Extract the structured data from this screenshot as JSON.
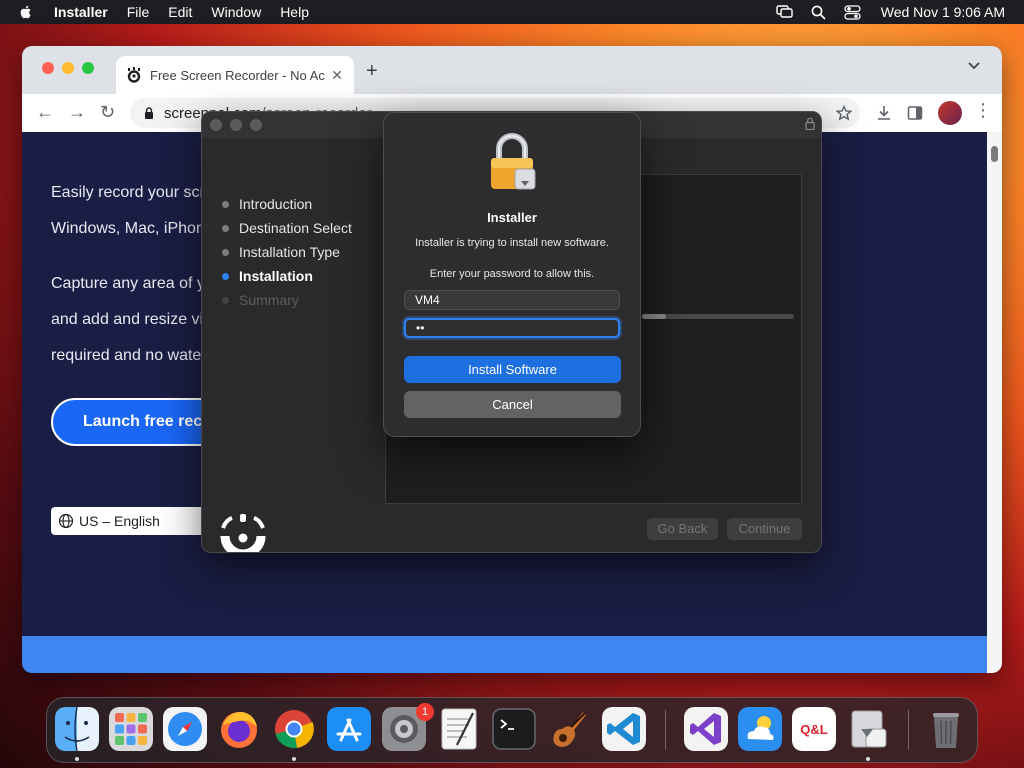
{
  "menubar": {
    "app_name": "Installer",
    "menus": [
      "File",
      "Edit",
      "Window",
      "Help"
    ],
    "clock": "Wed Nov 1  9:06 AM",
    "icons": [
      "apple-icon",
      "screen-mirroring-icon",
      "search-icon",
      "control-center-icon"
    ]
  },
  "browser": {
    "tab_title": "Free Screen Recorder - No Ac",
    "url_main": "screenpal.com",
    "url_rest": "/screen-recorder",
    "colors": {
      "page_bg": "#1b1e44",
      "accent": "#1a66f5"
    }
  },
  "page": {
    "lines": [
      "Easily record your scr",
      "Windows, Mac, iPhon",
      "Capture any area of yo",
      "and add and resize vic",
      "required and no water"
    ],
    "launch_label": "Launch free reco",
    "language": "US – English"
  },
  "installer": {
    "steps": [
      {
        "label": "Introduction",
        "state": "done"
      },
      {
        "label": "Destination Select",
        "state": "done"
      },
      {
        "label": "Installation Type",
        "state": "done"
      },
      {
        "label": "Installation",
        "state": "active"
      },
      {
        "label": "Summary",
        "state": "pending"
      }
    ],
    "progress": 0.16,
    "go_back": "Go Back",
    "continue": "Continue"
  },
  "auth": {
    "title": "Installer",
    "message": "Installer is trying to install new software.",
    "prompt": "Enter your password to allow this.",
    "username": "VM4",
    "password_mask": "••",
    "install_button": "Install Software",
    "cancel_button": "Cancel"
  },
  "dock": {
    "apps": [
      "Finder",
      "Launchpad",
      "Safari",
      "Firefox",
      "Chrome",
      "App Store",
      "System Settings",
      "TextEdit",
      "Terminal",
      "GarageBand",
      "Visual Studio Code",
      "Visual Studio",
      "Weather",
      "QOL",
      "Installer",
      "Trash"
    ],
    "settings_badge": "1",
    "qol_text": "Q&L"
  }
}
